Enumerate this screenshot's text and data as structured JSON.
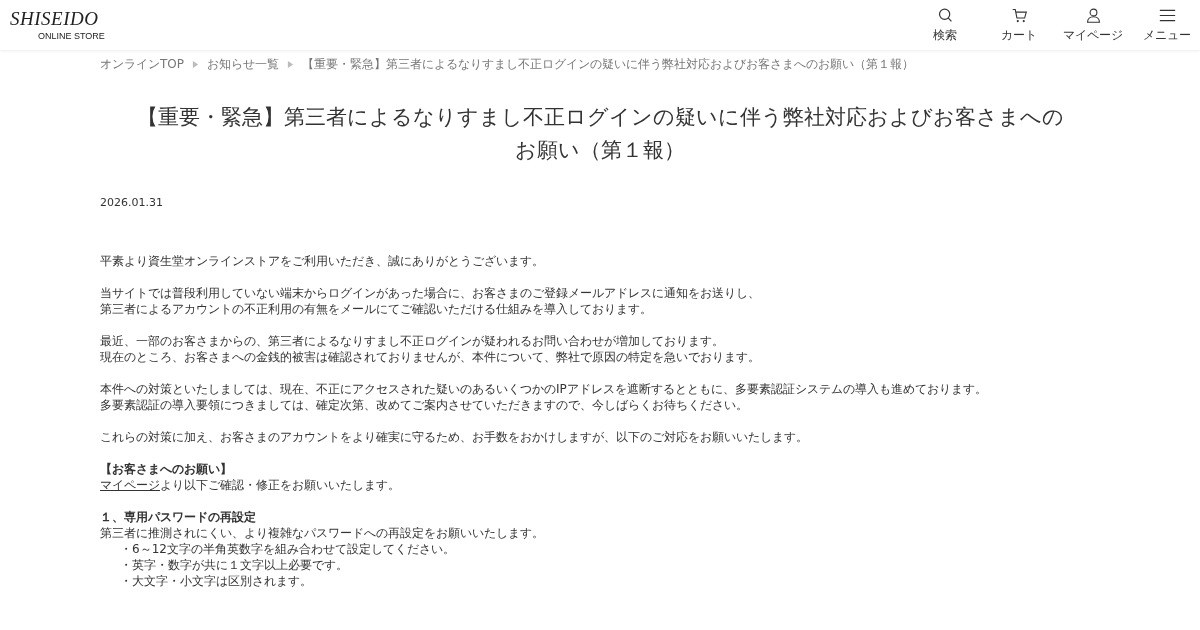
{
  "header": {
    "logo": "SHISEIDO",
    "logo_sub": "ONLINE STORE",
    "nav": [
      {
        "kind": "search",
        "label": "検索"
      },
      {
        "kind": "cart",
        "label": "カート"
      },
      {
        "kind": "person",
        "label": "マイページ"
      },
      {
        "kind": "menu",
        "label": "メニュー"
      }
    ]
  },
  "breadcrumb": [
    "オンラインTOP",
    "お知らせ一覧",
    "【重要・緊急】第三者によるなりすまし不正ログインの疑いに伴う弊社対応およびお客さまへのお願い（第１報）"
  ],
  "title": "【重要・緊急】第三者によるなりすまし不正ログインの疑いに伴う弊社対応およびお客さまへのお願い（第１報）",
  "date": "2026.01.31",
  "blocks": [
    {
      "kind": "para",
      "lines": [
        "平素より資生堂オンラインストアをご利用いただき、誠にありがとうございます。"
      ]
    },
    {
      "kind": "para",
      "lines": [
        "当サイトでは普段利用していない端末からログインがあった場合に、お客さまのご登録メールアドレスに通知をお送りし、",
        "第三者によるアカウントの不正利用の有無をメールにてご確認いただける仕組みを導入しております。"
      ]
    },
    {
      "kind": "para",
      "lines": [
        "最近、一部のお客さまからの、第三者によるなりすまし不正ログインが疑われるお問い合わせが増加しております。",
        "現在のところ、お客さまへの金銭的被害は確認されておりませんが、本件について、弊社で原因の特定を急いでおります。"
      ]
    },
    {
      "kind": "para",
      "lines": [
        "本件への対策といたしましては、現在、不正にアクセスされた疑いのあるいくつかのIPアドレスを遮断するとともに、多要素認証システムの導入も進めております。",
        "多要素認証の導入要領につきましては、確定次第、改めてご案内させていただきますので、今しばらくお待ちください。"
      ]
    },
    {
      "kind": "para",
      "lines": [
        "これらの対策に加え、お客さまのアカウントをより確実に守るため、お手数をおかけしますが、以下のご対応をお願いいたします。"
      ]
    },
    {
      "kind": "heading",
      "text": "【お客さまへのお願い】"
    },
    {
      "kind": "link",
      "link": "マイページ",
      "text": "より以下ご確認・修正をお願いいたします。"
    },
    {
      "kind": "heading",
      "text": "１、専用パスワードの再設定"
    },
    {
      "kind": "line",
      "text": "第三者に推測されにくい、より複雑なパスワードへの再設定をお願いいたします。"
    },
    {
      "kind": "bullet",
      "text": "・6～12文字の半角英数字を組み合わせて設定してください。"
    },
    {
      "kind": "bullet",
      "text": "・英字・数字が共に１文字以上必要です。"
    },
    {
      "kind": "bullet",
      "text": "・大文字・小文字は区別されます。"
    }
  ]
}
